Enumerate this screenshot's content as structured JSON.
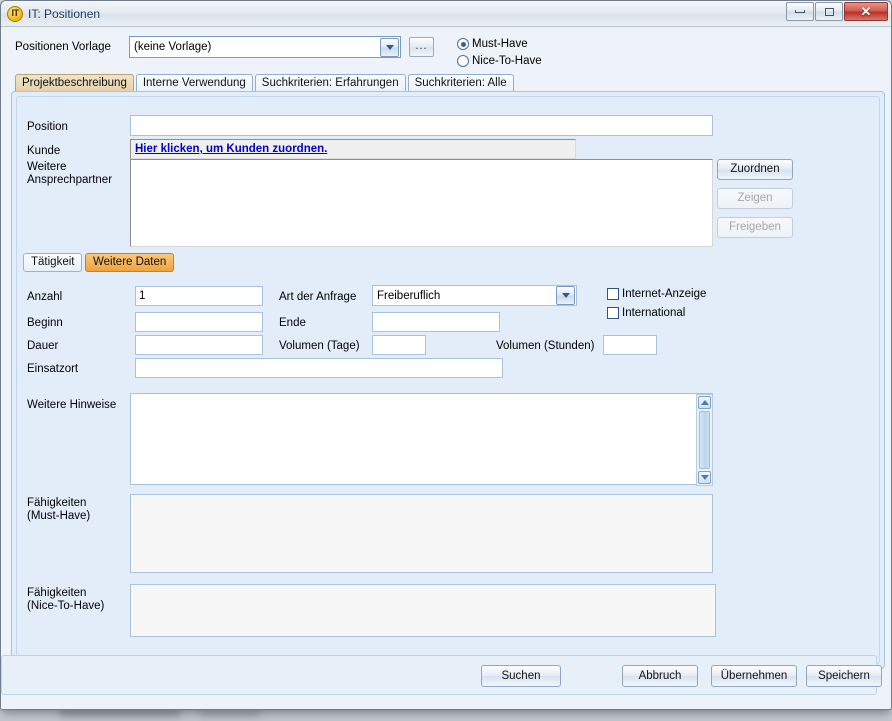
{
  "window": {
    "title": "IT: Positionen",
    "icon_label": "IT",
    "icon_name": "app-icon-it",
    "minimize_name": "minimize-icon",
    "maximize_name": "maximize-icon",
    "close_label": "✕"
  },
  "template_row": {
    "label": "Positionen Vorlage",
    "combo_value": "(keine Vorlage)",
    "browse_label": "...",
    "radios": [
      {
        "label": "Must-Have",
        "selected": true
      },
      {
        "label": "Nice-To-Have",
        "selected": false
      }
    ]
  },
  "tabs": [
    {
      "label": "Projektbeschreibung",
      "active": true
    },
    {
      "label": "Interne Verwendung",
      "active": false
    },
    {
      "label": "Suchkriterien: Erfahrungen",
      "active": false
    },
    {
      "label": "Suchkriterien: Alle",
      "active": false
    }
  ],
  "form": {
    "position_label": "Position",
    "position_value": "",
    "kunde_label": "Kunde",
    "kunde_link": "Hier klicken, um Kunden zuordnen.",
    "ansprechpartner_label_line1": "Weitere",
    "ansprechpartner_label_line2": "Ansprechpartner",
    "ansprechpartner_value": ""
  },
  "side_buttons": [
    {
      "label": "Zuordnen",
      "enabled": true
    },
    {
      "label": "Zeigen",
      "enabled": false
    },
    {
      "label": "Freigeben",
      "enabled": false
    }
  ],
  "inner_tabs": [
    {
      "label": "Tätigkeit",
      "active": false
    },
    {
      "label": "Weitere Daten",
      "active": true
    }
  ],
  "details": {
    "anzahl_label": "Anzahl",
    "anzahl_value": "1",
    "beginn_label": "Beginn",
    "beginn_value": "",
    "dauer_label": "Dauer",
    "dauer_value": "",
    "einsatzort_label": "Einsatzort",
    "einsatzort_value": "",
    "art_label": "Art der Anfrage",
    "art_value": "Freiberuflich",
    "ende_label": "Ende",
    "ende_value": "",
    "volumen_tage_label": "Volumen (Tage)",
    "volumen_tage_value": "",
    "volumen_stunden_label": "Volumen (Stunden)",
    "volumen_stunden_value": "",
    "checkboxes": [
      {
        "label": "Internet-Anzeige",
        "checked": false
      },
      {
        "label": "International",
        "checked": false
      }
    ]
  },
  "notes": {
    "hinweise_label": "Weitere Hinweise",
    "hinweise_value": "",
    "must_have_label_line1": "Fähigkeiten",
    "must_have_label_line2": "(Must-Have)",
    "must_have_value": "",
    "nice_label_line1": "Fähigkeiten",
    "nice_label_line2": "(Nice-To-Have)",
    "nice_value": ""
  },
  "bottom_buttons": [
    {
      "label": "Suchen"
    },
    {
      "label": "Abbruch"
    },
    {
      "label": "Übernehmen"
    },
    {
      "label": "Speichern"
    }
  ],
  "colors": {
    "panel_bg": "#e3edfa",
    "accent_tab_active": "#f0a33c",
    "link": "#0000c8",
    "close_button": "#b73326"
  }
}
